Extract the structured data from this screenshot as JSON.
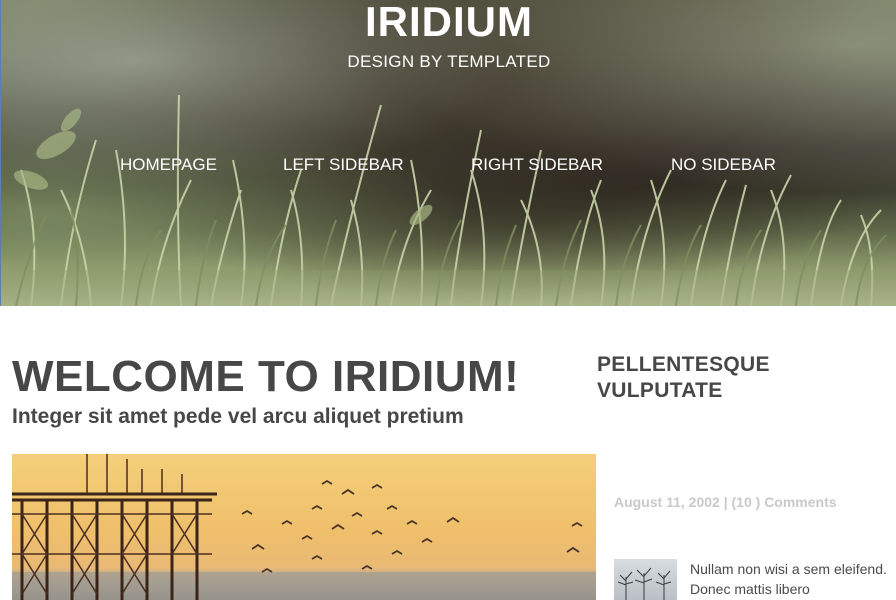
{
  "site": {
    "title": "IRIDIUM",
    "subtitle": "DESIGN BY TEMPLATED"
  },
  "nav": {
    "items": [
      {
        "label": "HOMEPAGE"
      },
      {
        "label": "LEFT SIDEBAR"
      },
      {
        "label": "RIGHT SIDEBAR"
      },
      {
        "label": "NO SIDEBAR"
      }
    ]
  },
  "main": {
    "heading": "WELCOME TO IRIDIUM!",
    "subheading": "Integer sit amet pede vel arcu aliquet pretium"
  },
  "sidebar": {
    "heading": "PELLENTESQUE VULPUTATE",
    "meta": "August 11, 2002 | (10 ) Comments",
    "text": "Nullam non wisi a sem eleifend. Donec mattis libero"
  },
  "colors": {
    "heading": "#474747",
    "meta": "#c9c9c9",
    "white": "#ffffff"
  }
}
